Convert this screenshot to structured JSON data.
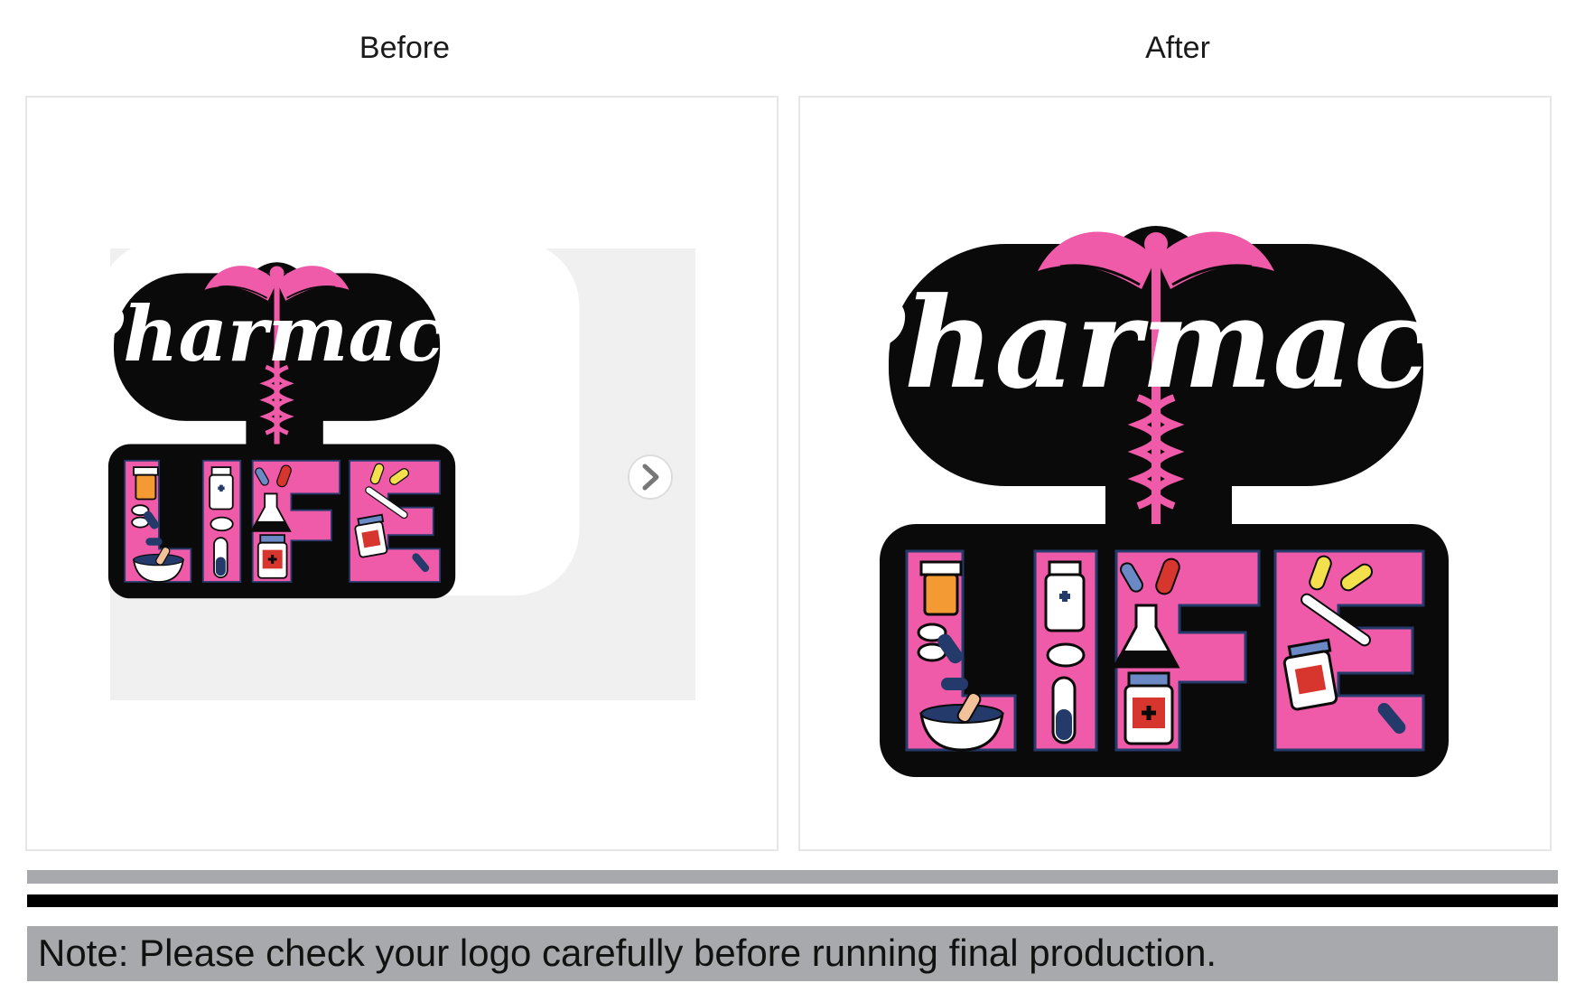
{
  "headings": {
    "before": "Before",
    "after": "After"
  },
  "logo": {
    "word1": "Pharmacy",
    "word2": "LIFE"
  },
  "colors": {
    "pink": "#ef5ba8",
    "pink_dark": "#e0398f",
    "black": "#0a0a0a",
    "white": "#ffffff",
    "mockup_bg": "#f0f0f0",
    "gray_bar": "#a7a9ac"
  },
  "icons": [
    "caduceus-icon",
    "pill-bottle-icon",
    "capsule-icon",
    "flask-icon",
    "thermometer-icon",
    "mortar-pestle-icon",
    "test-tube-icon",
    "tablet-icon",
    "next-arrow-icon"
  ],
  "note": "Note: Please check your logo carefully before running final production."
}
